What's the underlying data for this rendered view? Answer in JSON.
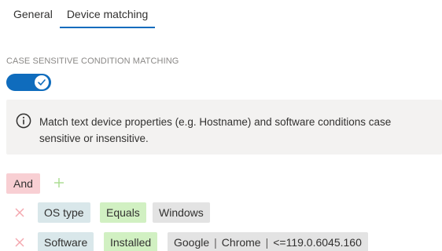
{
  "tabs": [
    {
      "label": "General",
      "active": false
    },
    {
      "label": "Device matching",
      "active": true
    }
  ],
  "case_sensitive": {
    "label": "CASE SENSITIVE CONDITION MATCHING",
    "enabled": true
  },
  "info": {
    "icon": "info-icon",
    "text": "Match text device properties (e.g. Hostname) and software conditions case sensitive or insensitive."
  },
  "conditions": {
    "operator": "And",
    "add_icon": "plus-icon",
    "rows": [
      {
        "remove_icon": "close-icon",
        "field": "OS type",
        "comparator": "Equals",
        "value": "Windows"
      },
      {
        "remove_icon": "close-icon",
        "field": "Software",
        "comparator": "Installed",
        "value_parts": [
          "Google",
          "Chrome",
          "<=119.0.6045.160"
        ]
      }
    ]
  },
  "colors": {
    "accent": "#0f6cbd",
    "and_chip": "#f8cfd3",
    "field_chip": "#d9e7ea",
    "comparator_chip": "#d1f0c2",
    "value_chip": "#e3e3e3",
    "remove_icon": "#f4a6ad",
    "add_icon": "#a8dc8e"
  }
}
